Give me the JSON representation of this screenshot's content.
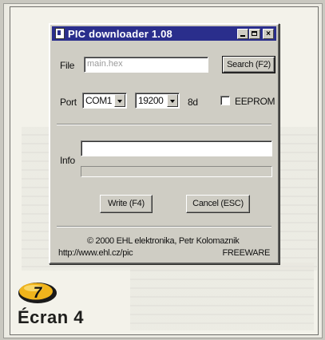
{
  "window": {
    "title": "PIC downloader 1.08",
    "close_glyph": "×"
  },
  "file": {
    "label": "File",
    "value": "main.hex",
    "search_button": "Search (F2)"
  },
  "port": {
    "label": "Port",
    "selected_port": "COM1",
    "selected_baud": "19200",
    "format": "8d",
    "eeprom_label": "EEPROM",
    "eeprom_checked": false
  },
  "info": {
    "label": "Info",
    "value": ""
  },
  "buttons": {
    "write": "Write (F4)",
    "cancel": "Cancel (ESC)"
  },
  "footer": {
    "copyright": "© 2000 EHL elektronika, Petr Kolomaznik",
    "url": "http://www.ehl.cz/pic",
    "license": "FREEWARE"
  },
  "page": {
    "badge_number": "7",
    "caption": "Écran 4"
  },
  "colors": {
    "titlebar": "#2a2e8c",
    "badge": "#f0b41c"
  }
}
